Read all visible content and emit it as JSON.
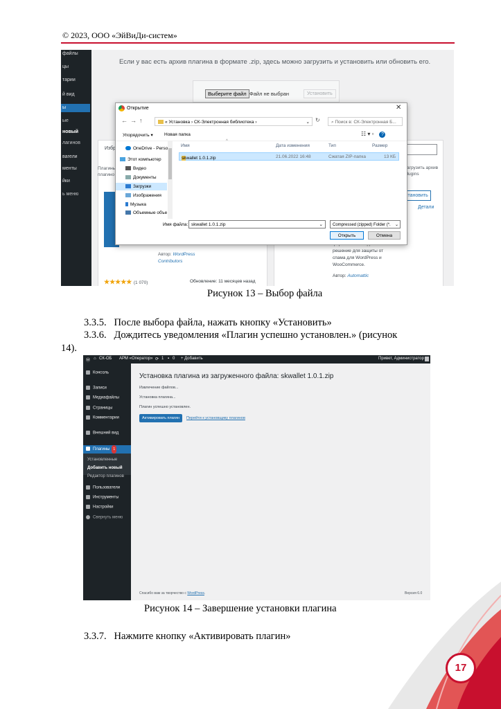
{
  "header": {
    "copyright": "© 2023, ООО «ЭйВиДи-систем»"
  },
  "figure13": {
    "sidebar_items": [
      "файлы",
      "цы",
      "тарии",
      "й вид",
      "ы",
      "ые",
      "новый",
      "лагинов",
      "вагели",
      "менты",
      "йки",
      "ь меню"
    ],
    "message": "Если у вас есть архив плагина в формате .zip, здесь можно загрузить и установить или обновить его.",
    "choose_file_button": "Выберите файл",
    "no_file_text": "Файл не выбран",
    "install_button_disabled": "Установить",
    "left_card_heading": "Избр",
    "left_card_text": [
      "Плагины",
      "плагино"
    ],
    "left_card_author_label": "Автор:",
    "left_card_author": "WordPress",
    "left_card_author2": "Contributors",
    "left_card_stars": "★★★★★",
    "left_card_rating_count": "(1 070)",
    "left_card_update": "Обновление: 11 месяцев назад",
    "right_zip_text": [
      "загрузить архив",
      "plugins"
    ],
    "right_install_button": "Установить",
    "right_details_link": "Детали",
    "right_desc": [
      "форм. Самое надёжное",
      "решение для защиты от",
      "спама для WordPress и",
      "WooCommerce."
    ],
    "right_author_label": "Автор:",
    "right_author": "Automattic",
    "dialog": {
      "title": "Открытие",
      "address": [
        "«",
        "Установка",
        "›",
        "СК-Электронная библиотека",
        "›"
      ],
      "search_placeholder": "Поиск в: СК-Электронная Б...",
      "organize": "Упорядочить ▾",
      "new_folder": "Новая папка",
      "nav_items": [
        "OneDrive - Person",
        "Этот компьютер",
        "Видео",
        "Документы",
        "Загрузки",
        "Изображения",
        "Музыка",
        "Объемные объе"
      ],
      "columns": [
        "Имя",
        "Дата изменения",
        "Тип",
        "Размер"
      ],
      "file": {
        "name": "skwallet 1.0.1.zip",
        "date": "21.06.2022 16:48",
        "type": "Сжатая ZIP-папка",
        "size": "13 КБ"
      },
      "filename_label": "Имя файла:",
      "filename_value": "skwallet 1.0.1.zip",
      "filetype_value": "Compressed (zipped) Folder (*.",
      "open_button": "Открыть",
      "cancel_button": "Отмена"
    }
  },
  "caption13": "Рисунок 13 – Выбор файла",
  "steps": [
    {
      "num": "3.3.5.",
      "text": "После выбора файла, нажать кнопку «Установить»"
    },
    {
      "num": "3.3.6.",
      "text": "Дождитесь уведомления «Плагин успешно установлен.» (рисунок"
    },
    {
      "cont": "14)."
    }
  ],
  "figure14": {
    "adminbar": [
      "СК-ОБ",
      "АРМ «Оператор»",
      "1",
      "0",
      "+ Добавить"
    ],
    "greeting": "Привет, Администратор",
    "sidebar": [
      "Консоль",
      "Записи",
      "Медиафайлы",
      "Страницы",
      "Комментарии",
      "Внешний вид",
      "Плагины",
      "Установленные",
      "Добавить новый",
      "Редактор плагинов",
      "Пользователи",
      "Инструменты",
      "Настройки",
      "Свернуть меню"
    ],
    "plugins_badge": "1",
    "title": "Установка плагина из загруженного файла: skwallet 1.0.1.zip",
    "lines": [
      "Извлечение файлов...",
      "Установка плагина...",
      "Плагин успешно установлен."
    ],
    "activate_button": "Активировать плагин",
    "back_link": "Перейти к установщику плагинов",
    "footer": "Спасибо вам за творчество с",
    "footer_link": "WordPress",
    "version": "Версия 6.0"
  },
  "caption14": "Рисунок 14 – Завершение установки плагина",
  "step_last": {
    "num": "3.3.7.",
    "text": "Нажмите кнопку «Активировать плагин»"
  },
  "page_number": "17",
  "colors": {
    "accent_red": "#c8102e",
    "wp_dark": "#1d2327",
    "wp_blue": "#2271b1"
  }
}
